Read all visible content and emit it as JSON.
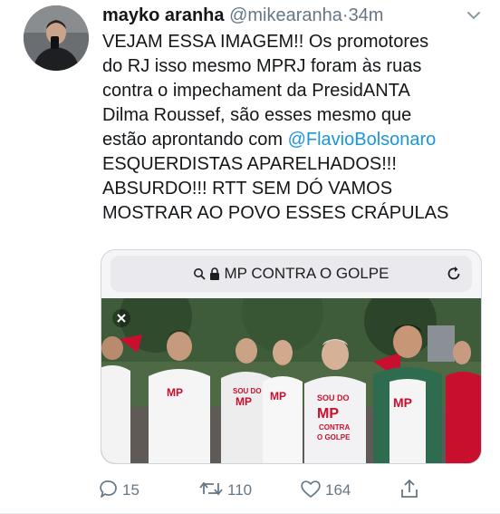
{
  "tweet": {
    "author_name": "mayko aranha",
    "handle": "@mikearanha",
    "separator": "·",
    "time": "34m",
    "text_lines": [
      "VEJAM ESSA IMAGEM!! Os promotores",
      "do RJ isso mesmo MPRJ foram às ruas",
      "contra o impechament da PresidANTA",
      "Dilma Roussef, são esses mesmo que",
      "ESQUERDISTAS APARELHADOS!!!",
      "ABSURDO!!! RTT SEM DÓ VAMOS",
      "MOSTRAR AO POVO ESSES CRÁPULAS"
    ],
    "line5_prefix": "estão aprontando com ",
    "mention": "@FlavioBolsonaro"
  },
  "card": {
    "url_text": "MP CONTRA O GOLPE",
    "shirt_text": [
      "SOU DO",
      "MP",
      "CONTRA",
      "O GOLPE"
    ]
  },
  "actions": {
    "reply_count": "15",
    "retweet_count": "110",
    "like_count": "164"
  },
  "colors": {
    "mention": "#1b95e0",
    "secondary_text": "#657786",
    "shirt_red": "#c8102e"
  },
  "icons": [
    "chevron-down-icon",
    "search-icon",
    "lock-icon",
    "reload-icon",
    "close-icon",
    "reply-icon",
    "retweet-icon",
    "like-icon",
    "share-icon"
  ]
}
